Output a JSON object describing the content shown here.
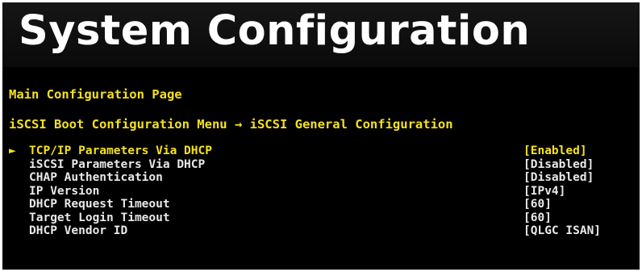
{
  "header": {
    "title": "System Configuration"
  },
  "main": {
    "page_title": "Main Configuration Page",
    "breadcrumb": "iSCSI Boot Configuration Menu → iSCSI General Configuration",
    "selection_marker": "►",
    "settings": [
      {
        "label": "TCP/IP Parameters Via DHCP",
        "value": "[Enabled]"
      },
      {
        "label": "iSCSI Parameters Via DHCP",
        "value": "[Disabled]"
      },
      {
        "label": "CHAP Authentication",
        "value": "[Disabled]"
      },
      {
        "label": "IP Version",
        "value": "[IPv4]"
      },
      {
        "label": "DHCP Request Timeout",
        "value": "[60]"
      },
      {
        "label": "Target Login Timeout",
        "value": "[60]"
      },
      {
        "label": "DHCP Vendor ID",
        "value": "[QLGC ISAN]"
      }
    ]
  },
  "colors": {
    "background": "#000000",
    "title": "#ffffff",
    "highlight": "#f5e11e",
    "text": "#e8e8e8"
  }
}
